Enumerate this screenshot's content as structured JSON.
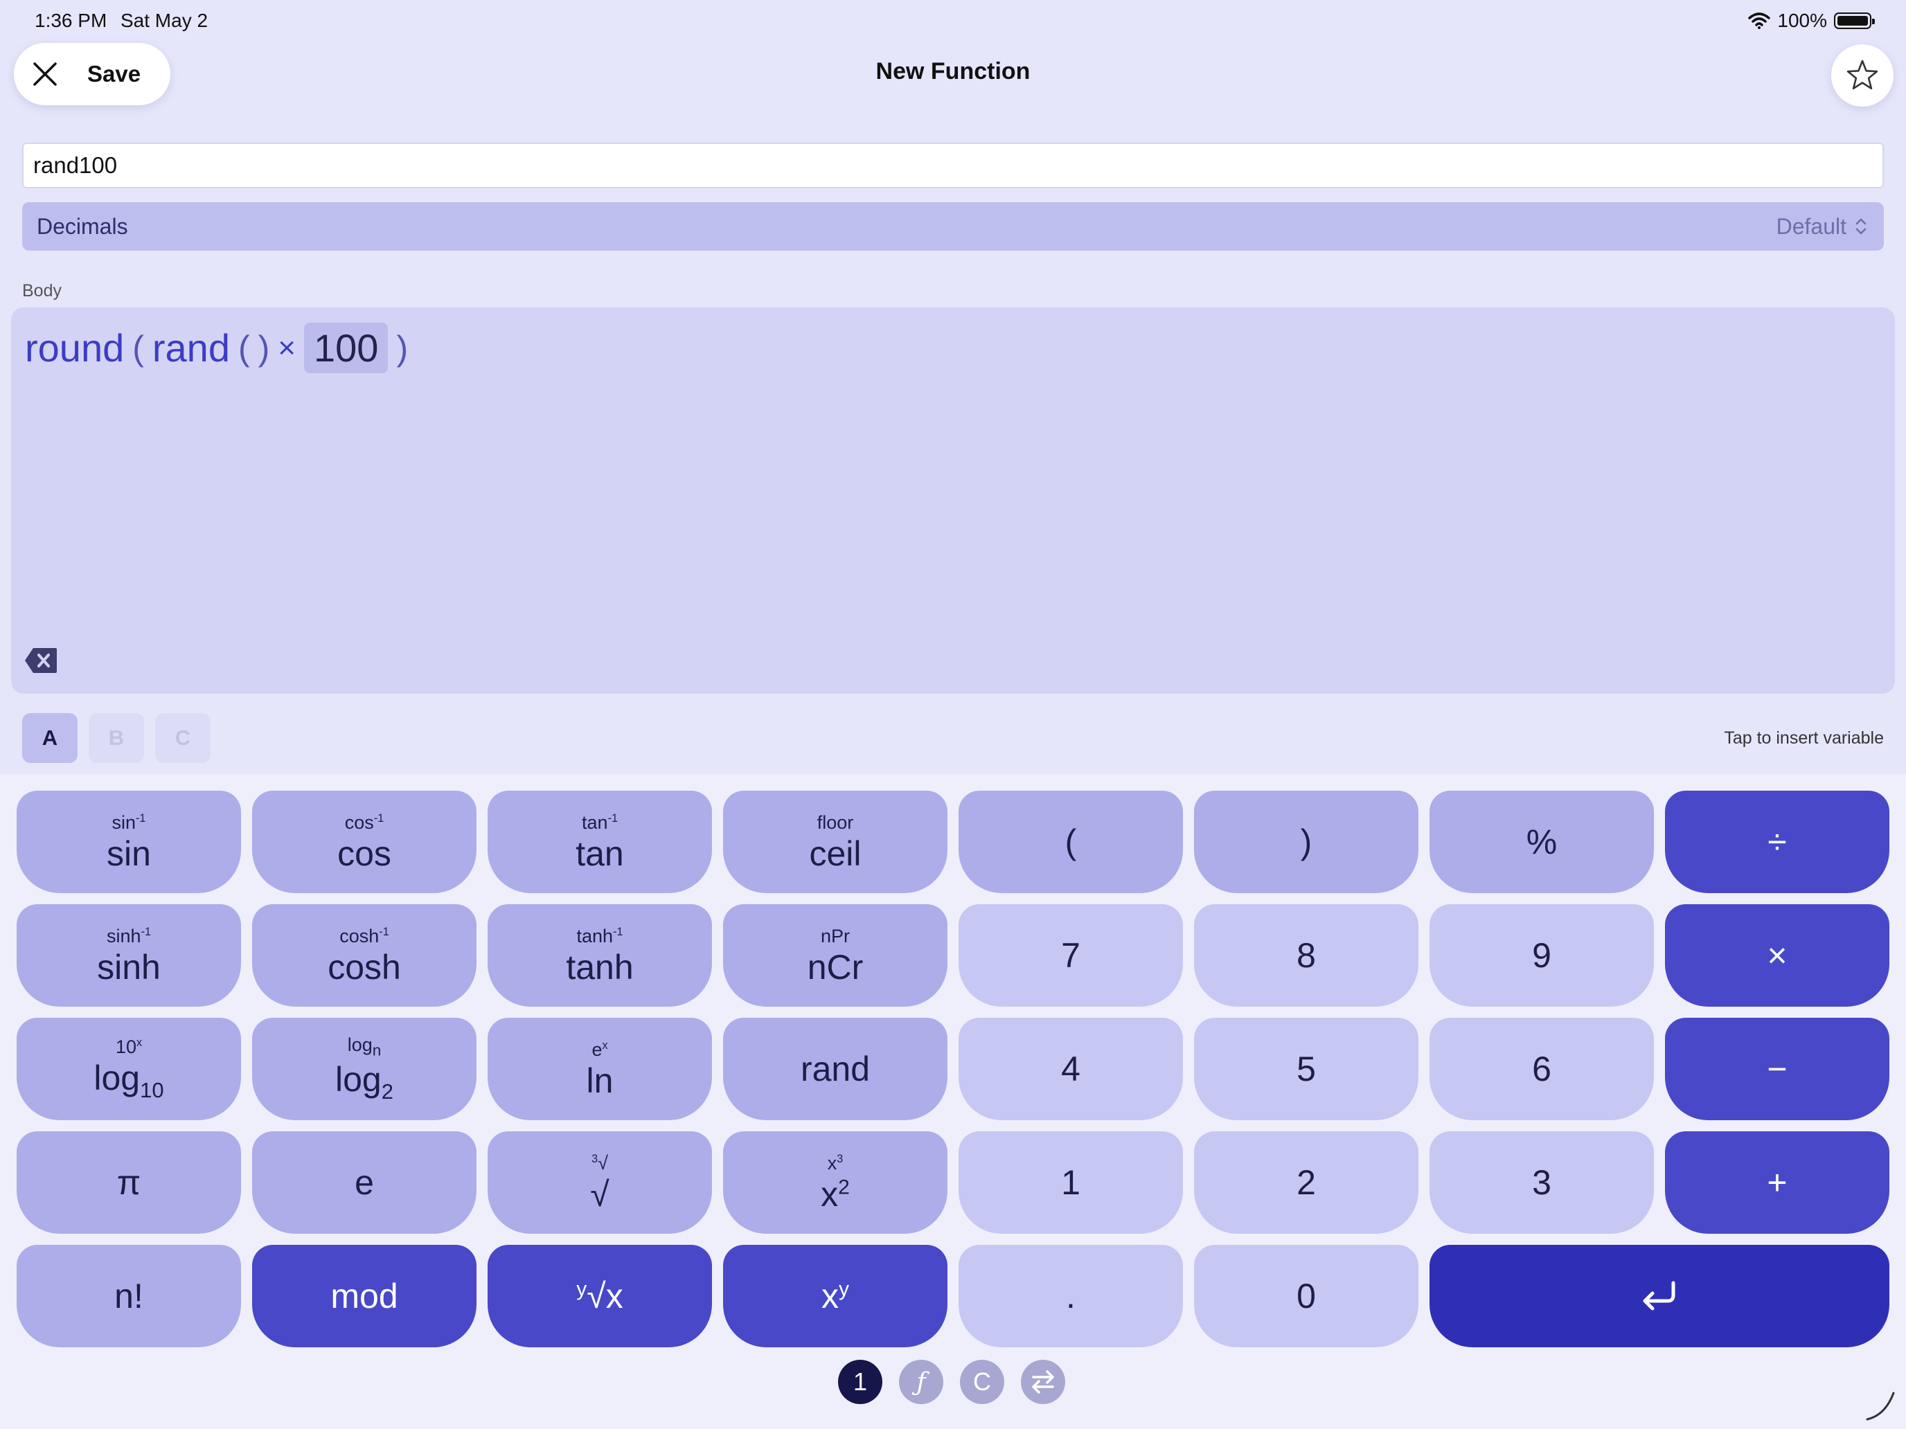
{
  "status_bar": {
    "time": "1:36 PM",
    "date": "Sat May 2",
    "battery": "100%"
  },
  "header": {
    "save_label": "Save",
    "title": "New Function"
  },
  "name_field": {
    "value": "rand100"
  },
  "decimals": {
    "label": "Decimals",
    "value": "Default"
  },
  "body": {
    "label": "Body",
    "expression": {
      "fn_round": "round",
      "lparen1": "(",
      "fn_rand": "rand",
      "lparen2": "(",
      "rparen2": ")",
      "times": "×",
      "number": "100",
      "rparen1": ")"
    }
  },
  "variables": {
    "items": [
      "A",
      "B",
      "C"
    ],
    "selected": "A",
    "hint": "Tap to insert variable"
  },
  "keypad": {
    "sin": {
      "main": "sin",
      "sub": "sin",
      "sub_sup": "-1"
    },
    "cos": {
      "main": "cos",
      "sub": "cos",
      "sub_sup": "-1"
    },
    "tan": {
      "main": "tan",
      "sub": "tan",
      "sub_sup": "-1"
    },
    "ceil": {
      "main": "ceil",
      "sub": "floor"
    },
    "lparen": "(",
    "rparen": ")",
    "percent": "%",
    "divide": "÷",
    "sinh": {
      "main": "sinh",
      "sub": "sinh",
      "sub_sup": "-1"
    },
    "cosh": {
      "main": "cosh",
      "sub": "cosh",
      "sub_sup": "-1"
    },
    "tanh": {
      "main": "tanh",
      "sub": "tanh",
      "sub_sup": "-1"
    },
    "ncr": {
      "main": "nCr",
      "sub": "nPr"
    },
    "seven": "7",
    "eight": "8",
    "nine": "9",
    "multiply": "×",
    "log10": {
      "main": "log",
      "main_sub": "10",
      "sub": "10",
      "sub_sup": "x"
    },
    "log2": {
      "main": "log",
      "main_sub": "2",
      "sub": "log",
      "sub_sub": "n"
    },
    "ln": {
      "main": "ln",
      "sub": "e",
      "sub_sup": "x"
    },
    "rand": "rand",
    "four": "4",
    "five": "5",
    "six": "6",
    "minus": "−",
    "pi": "π",
    "e": "e",
    "sqrt": {
      "main": "√",
      "sub": "√",
      "sub_sup": "3"
    },
    "square": {
      "main": "x",
      "main_sup": "2",
      "sub": "x",
      "sub_sup": "3"
    },
    "one": "1",
    "two": "2",
    "three": "3",
    "plus": "+",
    "factorial": "n!",
    "mod": "mod",
    "yroot": {
      "main": "√x",
      "main_sup": "y"
    },
    "power": {
      "main": "x",
      "main_sup": "y"
    },
    "dot": ".",
    "zero": "0"
  },
  "pages": [
    "1",
    "ƒ",
    "C"
  ],
  "icons": {
    "close": "close-icon",
    "favorite": "star-icon",
    "backspace": "backspace-icon",
    "enter": "return-icon",
    "swap": "swap-icon",
    "wifi": "wifi-icon",
    "battery": "battery-icon"
  },
  "colors": {
    "background": "#e6e6fb",
    "operator_key": "#4848c8",
    "enter_key": "#2f2fb6",
    "function_key": "#adadea",
    "number_key": "#c7c7f4",
    "accent_text": "#3c3cc4"
  }
}
